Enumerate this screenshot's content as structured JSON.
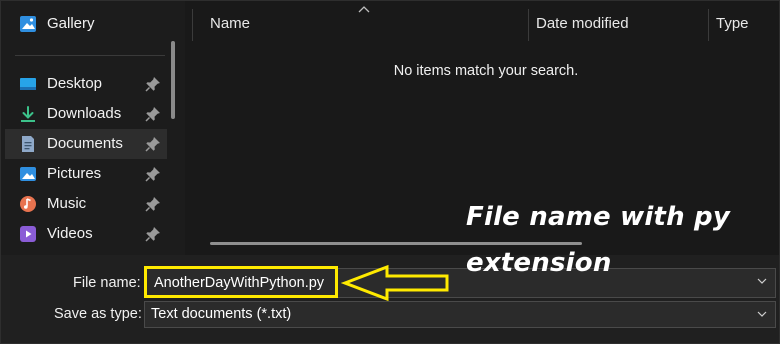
{
  "nav": {
    "items": [
      {
        "label": "Gallery",
        "icon": "gallery-icon",
        "pinned": false,
        "selected": false
      },
      {
        "label": "Desktop",
        "icon": "desktop-icon",
        "pinned": true,
        "selected": false
      },
      {
        "label": "Downloads",
        "icon": "download-icon",
        "pinned": true,
        "selected": false
      },
      {
        "label": "Documents",
        "icon": "documents-icon",
        "pinned": true,
        "selected": true
      },
      {
        "label": "Pictures",
        "icon": "pictures-icon",
        "pinned": true,
        "selected": false
      },
      {
        "label": "Music",
        "icon": "music-icon",
        "pinned": true,
        "selected": false
      },
      {
        "label": "Videos",
        "icon": "videos-icon",
        "pinned": true,
        "selected": false
      }
    ]
  },
  "list": {
    "columns": [
      "Name",
      "Date modified",
      "Type"
    ],
    "empty_message": "No items match your search."
  },
  "form": {
    "file_name_label": "File name:",
    "file_name_value": "AnotherDayWithPython.py",
    "save_type_label": "Save as type:",
    "save_type_value": "Text documents (*.txt)"
  },
  "annotation": {
    "line1": "File name with py",
    "line2": "extension"
  },
  "colors": {
    "background": "#191919",
    "highlight": "#ffea00",
    "selected": "#2d2d2d"
  }
}
